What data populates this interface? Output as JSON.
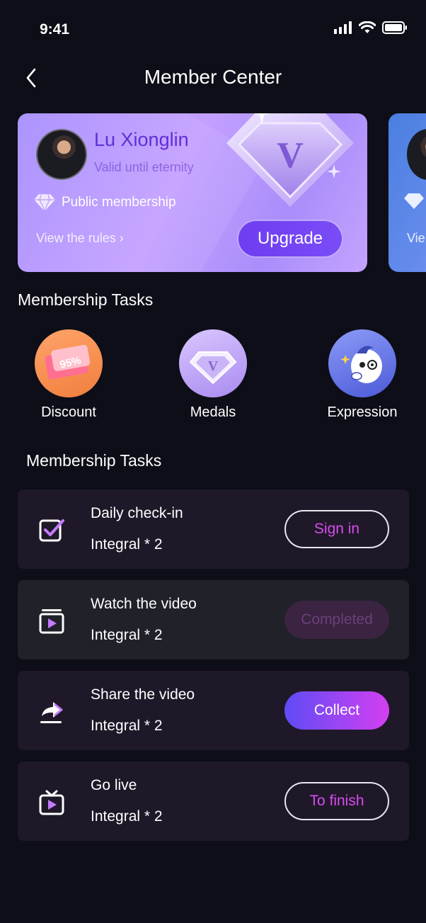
{
  "status": {
    "time": "9:41",
    "icons": [
      "signal-icon",
      "wifi-icon",
      "battery-icon"
    ]
  },
  "nav": {
    "title": "Member Center",
    "back_icon": "chevron-left-icon"
  },
  "card": {
    "name": "Lu Xionglin",
    "validity": "Valid until eternity",
    "tier": "Public membership",
    "rules": "View the rules ›",
    "upgrade": "Upgrade",
    "badge_letter": "V"
  },
  "card_peek": {
    "rules": "Vie"
  },
  "privileges": {
    "title": "Membership Tasks",
    "items": [
      {
        "label": "Discount",
        "badge": "95%"
      },
      {
        "label": "Medals",
        "badge": "V"
      },
      {
        "label": "Expression",
        "badge": ""
      }
    ]
  },
  "tasks": {
    "title": "Membership Tasks",
    "items": [
      {
        "name": "Daily check-in",
        "points": "Integral * 2",
        "button": "Sign in",
        "icon": "checkbox-icon"
      },
      {
        "name": "Watch the video",
        "points": "Integral * 2",
        "button": "Completed",
        "icon": "video-play-icon"
      },
      {
        "name": "Share the video",
        "points": "Integral * 2",
        "button": "Collect",
        "icon": "share-icon"
      },
      {
        "name": "Go live",
        "points": "Integral * 2",
        "button": "To finish",
        "icon": "tv-live-icon"
      }
    ]
  },
  "colors": {
    "background": "#0d0e17",
    "accent": "#d84bf2",
    "card": "#b496ff",
    "upgrade": "#6e3df0"
  }
}
